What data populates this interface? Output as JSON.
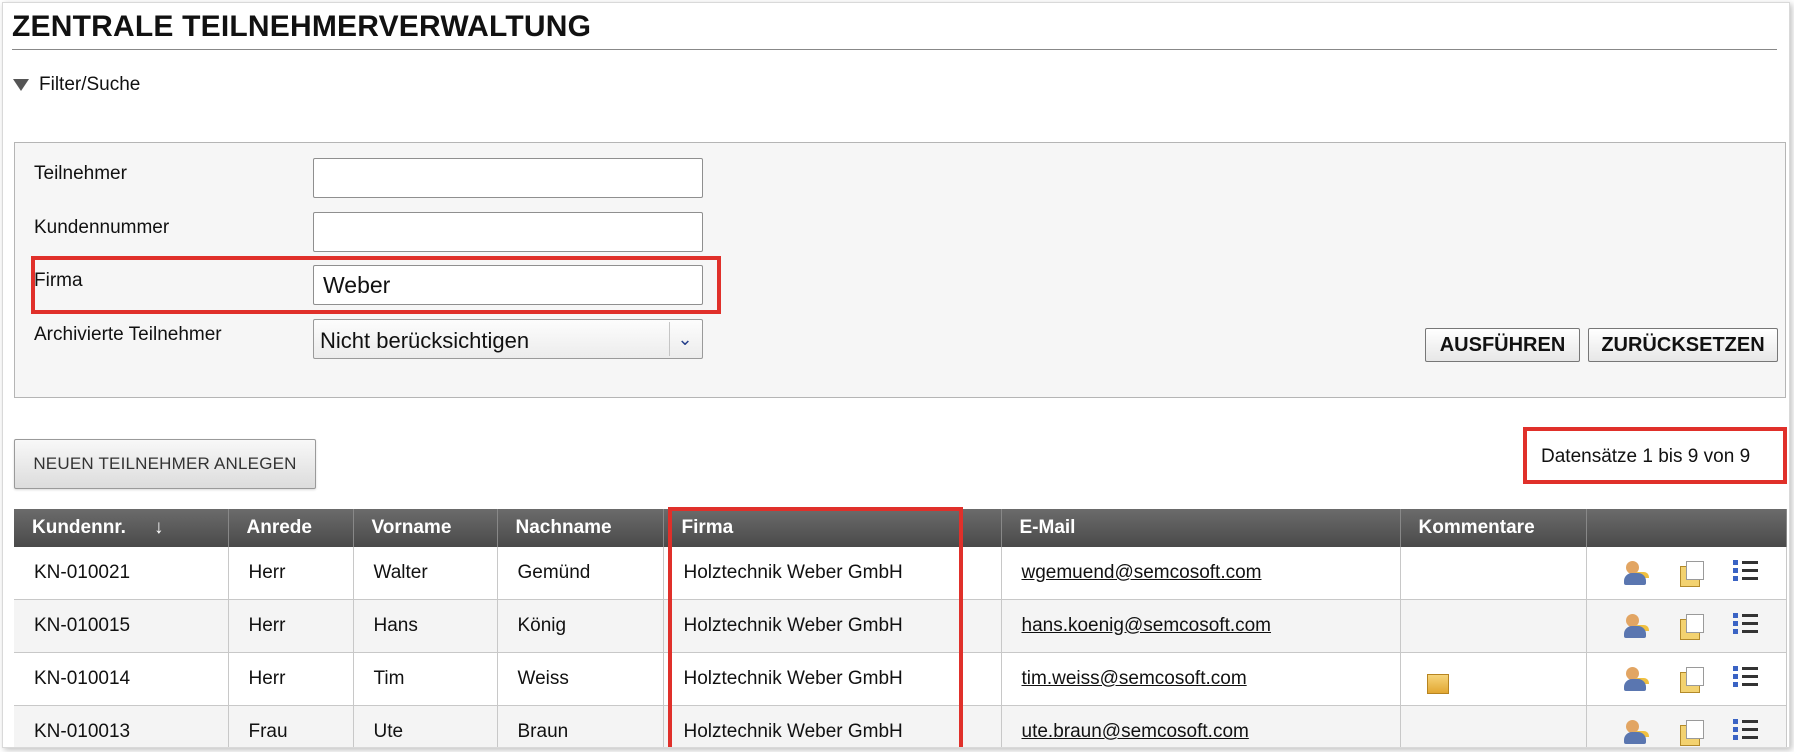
{
  "page": {
    "title": "ZENTRALE TEILNEHMERVERWALTUNG",
    "filter_toggle": "Filter/Suche"
  },
  "filter": {
    "fields": [
      {
        "label": "Teilnehmer",
        "value": ""
      },
      {
        "label": "Kundennummer",
        "value": ""
      },
      {
        "label": "Firma",
        "value": "Weber"
      }
    ],
    "archived": {
      "label": "Archivierte Teilnehmer",
      "selected": "Nicht berücksichtigen"
    },
    "execute_label": "AUSFÜHREN",
    "reset_label": "ZURÜCKSETZEN"
  },
  "actions": {
    "new_participant_label": "NEUEN TEILNEHMER ANLEGEN"
  },
  "records_info": "Datensätze 1 bis 9 von 9",
  "table": {
    "columns": [
      "Kundennr.",
      "Anrede",
      "Vorname",
      "Nachname",
      "Firma",
      "E-Mail",
      "Kommentare"
    ],
    "sort_indicator": "↓",
    "rows": [
      {
        "kundennr": "KN-010021",
        "anrede": "Herr",
        "vorname": "Walter",
        "nachname": "Gemünd",
        "firma": "Holztechnik Weber GmbH",
        "email": "wgemuend@semcosoft.com",
        "comment": false
      },
      {
        "kundennr": "KN-010015",
        "anrede": "Herr",
        "vorname": "Hans",
        "nachname": "König",
        "firma": "Holztechnik Weber GmbH",
        "email": "hans.koenig@semcosoft.com",
        "comment": false
      },
      {
        "kundennr": "KN-010014",
        "anrede": "Herr",
        "vorname": "Tim",
        "nachname": "Weiss",
        "firma": "Holztechnik Weber GmbH",
        "email": "tim.weiss@semcosoft.com",
        "comment": true
      },
      {
        "kundennr": "KN-010013",
        "anrede": "Frau",
        "vorname": "Ute",
        "nachname": "Braun",
        "firma": "Holztechnik Weber GmbH",
        "email": "ute.braun@semcosoft.com",
        "comment": false
      }
    ]
  },
  "colors": {
    "highlight": "#e0302a",
    "header_bg": "#555555"
  },
  "icons": [
    "triangle-down-icon",
    "chevron-down-icon",
    "edit-participant-icon",
    "copy-participant-icon",
    "details-list-icon",
    "comment-note-icon"
  ]
}
